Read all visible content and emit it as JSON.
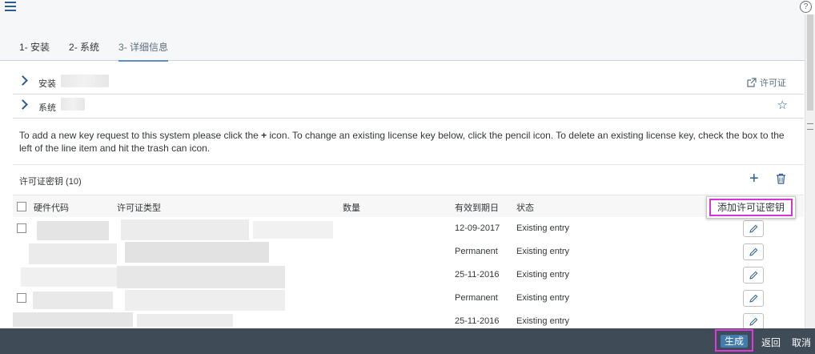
{
  "header": {
    "tabs": [
      {
        "label": "1- 安装"
      },
      {
        "label": "2- 系统"
      },
      {
        "label": "3- 详细信息"
      }
    ],
    "help_label": "?"
  },
  "sections": {
    "install_label": "安装",
    "system_label": "系统",
    "license_link_label": "许可证"
  },
  "info": {
    "part1": "To add a new key request to this system please click the ",
    "plus_char": "+",
    "part2": " icon. To change an existing license key below, click the pencil icon. To delete an existing license key, check the box to the left of the line item and hit the trash can icon."
  },
  "table": {
    "title": "许可证密钥 (10)",
    "columns": {
      "hardware_code": "硬件代码",
      "license_type": "许可证类型",
      "quantity": "数量",
      "expiry": "有效到期日",
      "status": "状态"
    },
    "rows": [
      {
        "expiry": "12-09-2017",
        "status": "Existing entry"
      },
      {
        "expiry": "Permanent",
        "status": "Existing entry"
      },
      {
        "expiry": "25-11-2016",
        "status": "Existing entry"
      },
      {
        "expiry": "Permanent",
        "status": "Existing entry"
      },
      {
        "expiry": "25-11-2016",
        "status": "Existing entry"
      }
    ]
  },
  "tooltip": {
    "add_key_label": "添加许可证密钥"
  },
  "footer": {
    "generate_label": "生成",
    "back_label": "返回",
    "cancel_label": "取消"
  },
  "icons": {
    "menu": "hamburger-icon",
    "help": "help-icon",
    "expand": "chevron-right-icon",
    "external_link": "external-link-icon",
    "favorite": "star-icon",
    "add": "plus-icon",
    "delete": "trash-icon",
    "edit": "pencil-icon"
  },
  "colors": {
    "accent": "#2a5c8f",
    "primary_button": "#427cac",
    "footer_bg": "#3f4b57",
    "highlight": "#d633d6"
  }
}
